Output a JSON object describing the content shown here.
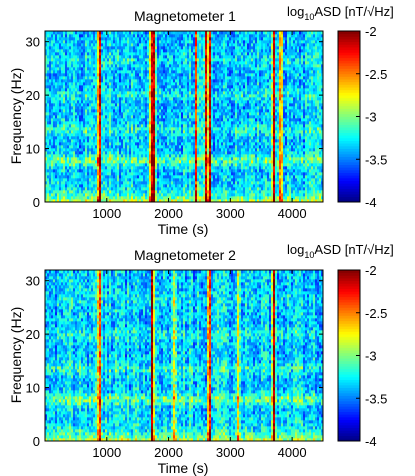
{
  "chart_data": [
    {
      "type": "heatmap",
      "title": "Magnetometer 1",
      "xlabel": "Time (s)",
      "ylabel": "Frequency (Hz)",
      "xlim": [
        0,
        4500
      ],
      "ylim": [
        0,
        32
      ],
      "x_ticks": [
        "1000",
        "2000",
        "3000",
        "4000"
      ],
      "x_tick_values": [
        1000,
        2000,
        3000,
        4000
      ],
      "y_ticks": [
        "0",
        "10",
        "20",
        "30"
      ],
      "y_tick_values": [
        0,
        10,
        20,
        30
      ],
      "colorbar": {
        "label_base": "log",
        "label_sub": "10",
        "label_rest": "ASD [nT/√Hz]",
        "range": [
          -4,
          -2
        ],
        "ticks": [
          "-2",
          "-2.5",
          "-3",
          "-3.5",
          "-4"
        ],
        "tick_values": [
          -2,
          -2.5,
          -3,
          -3.5,
          -4
        ],
        "colormap": "jet"
      },
      "background_level": -3.35,
      "horizontal_bands": [
        {
          "freq": 7.8,
          "level": -3.0
        },
        {
          "freq": 13.5,
          "level": -3.15
        },
        {
          "freq": 20.0,
          "level": -3.2
        },
        {
          "freq": 26.5,
          "level": -3.25
        }
      ],
      "vertical_bursts": [
        {
          "time": 880,
          "level": -2.0
        },
        {
          "time": 1720,
          "level": -2.1
        },
        {
          "time": 1760,
          "level": -2.0
        },
        {
          "time": 2660,
          "level": -2.0
        },
        {
          "time": 2600,
          "level": -2.2
        },
        {
          "time": 2450,
          "level": -2.3
        },
        {
          "time": 3700,
          "level": -2.1
        },
        {
          "time": 3820,
          "level": -2.3
        }
      ]
    },
    {
      "type": "heatmap",
      "title": "Magnetometer 2",
      "xlabel": "Time (s)",
      "ylabel": "Frequency (Hz)",
      "xlim": [
        0,
        4500
      ],
      "ylim": [
        0,
        32
      ],
      "x_ticks": [
        "1000",
        "2000",
        "3000",
        "4000"
      ],
      "x_tick_values": [
        1000,
        2000,
        3000,
        4000
      ],
      "y_ticks": [
        "0",
        "10",
        "20",
        "30"
      ],
      "y_tick_values": [
        0,
        10,
        20,
        30
      ],
      "colorbar": {
        "label_base": "log",
        "label_sub": "10",
        "label_rest": "ASD [nT/√Hz]",
        "range": [
          -4,
          -2
        ],
        "ticks": [
          "-2",
          "-2.5",
          "-3",
          "-3.5",
          "-4"
        ],
        "tick_values": [
          -2,
          -2.5,
          -3,
          -3.5,
          -4
        ],
        "colormap": "jet"
      },
      "background_level": -3.35,
      "horizontal_bands": [
        {
          "freq": 7.8,
          "level": -3.0
        },
        {
          "freq": 13.5,
          "level": -3.15
        },
        {
          "freq": 20.0,
          "level": -3.2
        },
        {
          "freq": 26.5,
          "level": -3.25
        }
      ],
      "vertical_bursts": [
        {
          "time": 880,
          "level": -2.1
        },
        {
          "time": 1740,
          "level": -2.0
        },
        {
          "time": 2660,
          "level": -2.0
        },
        {
          "time": 3700,
          "level": -2.0
        },
        {
          "time": 2100,
          "level": -2.6
        },
        {
          "time": 3120,
          "level": -2.7
        }
      ]
    }
  ]
}
